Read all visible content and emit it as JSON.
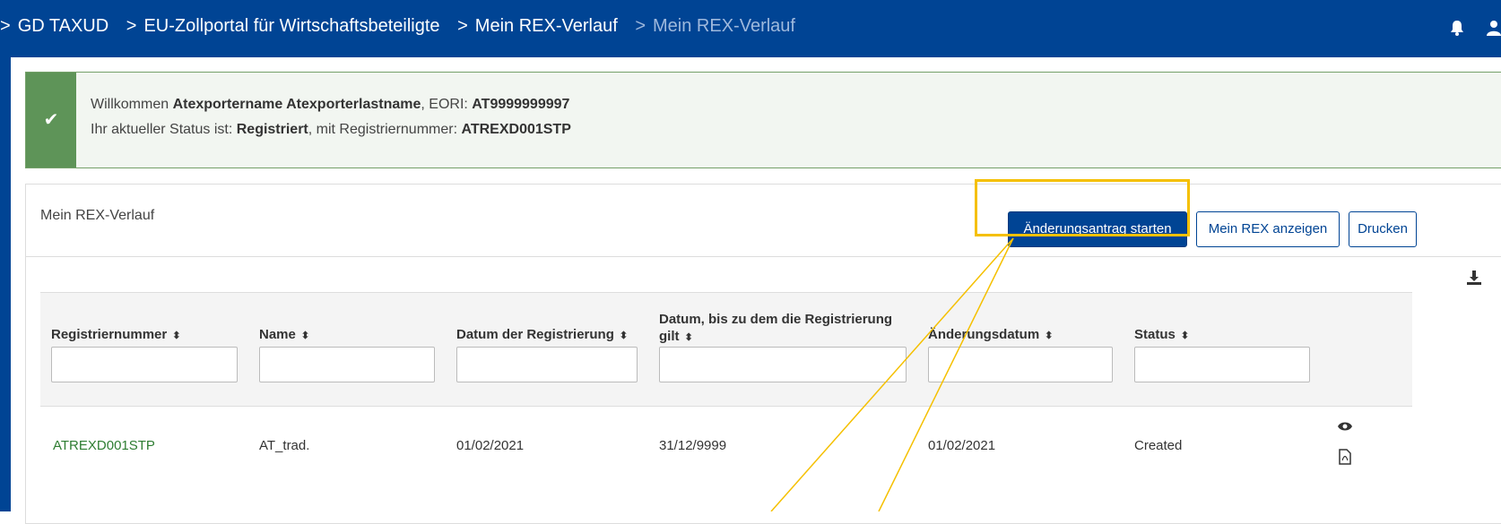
{
  "breadcrumb": [
    {
      "label": "GD TAXUD"
    },
    {
      "label": "EU-Zollportal für Wirtschaftsbeteiligte"
    },
    {
      "label": "Mein REX-Verlauf"
    },
    {
      "label": "Mein REX-Verlauf"
    }
  ],
  "breadcrumb_sep": ">",
  "welcome": {
    "line1_prefix": "Willkommen ",
    "user_name": "Atexportername Atexporterlastname",
    "eori_label": ", EORI: ",
    "eori_value": "AT9999999997",
    "line2_prefix": "Ihr aktueller Status ist: ",
    "status": "Registriert",
    "line2_mid": ", mit Registriernummer: ",
    "reg_number": "ATREXD001STP"
  },
  "panel": {
    "title": "Mein REX-Verlauf",
    "btn_change": "Änderungsantrag starten",
    "btn_show": "Mein REX anzeigen",
    "btn_print": "Drucken"
  },
  "table": {
    "columns": [
      {
        "label": "Registriernummer"
      },
      {
        "label": "Name"
      },
      {
        "label": "Datum der Registrierung"
      },
      {
        "label": "Datum, bis zu dem die Registrierung gilt"
      },
      {
        "label": "Änderungsdatum"
      },
      {
        "label": "Status"
      }
    ],
    "sort_glyph": "⬍",
    "rows": [
      [
        "ATREXD001STP",
        "AT_trad.",
        "01/02/2021",
        "31/12/9999",
        "01/02/2021",
        "Created"
      ]
    ]
  },
  "icons": {
    "bell": "bell-icon",
    "user": "user-icon",
    "check": "check-icon",
    "download": "download-icon",
    "view": "eye-icon",
    "pdf": "pdf-icon"
  },
  "colors": {
    "brand": "#004494",
    "success": "#5e9458",
    "highlight": "#f5c000"
  }
}
